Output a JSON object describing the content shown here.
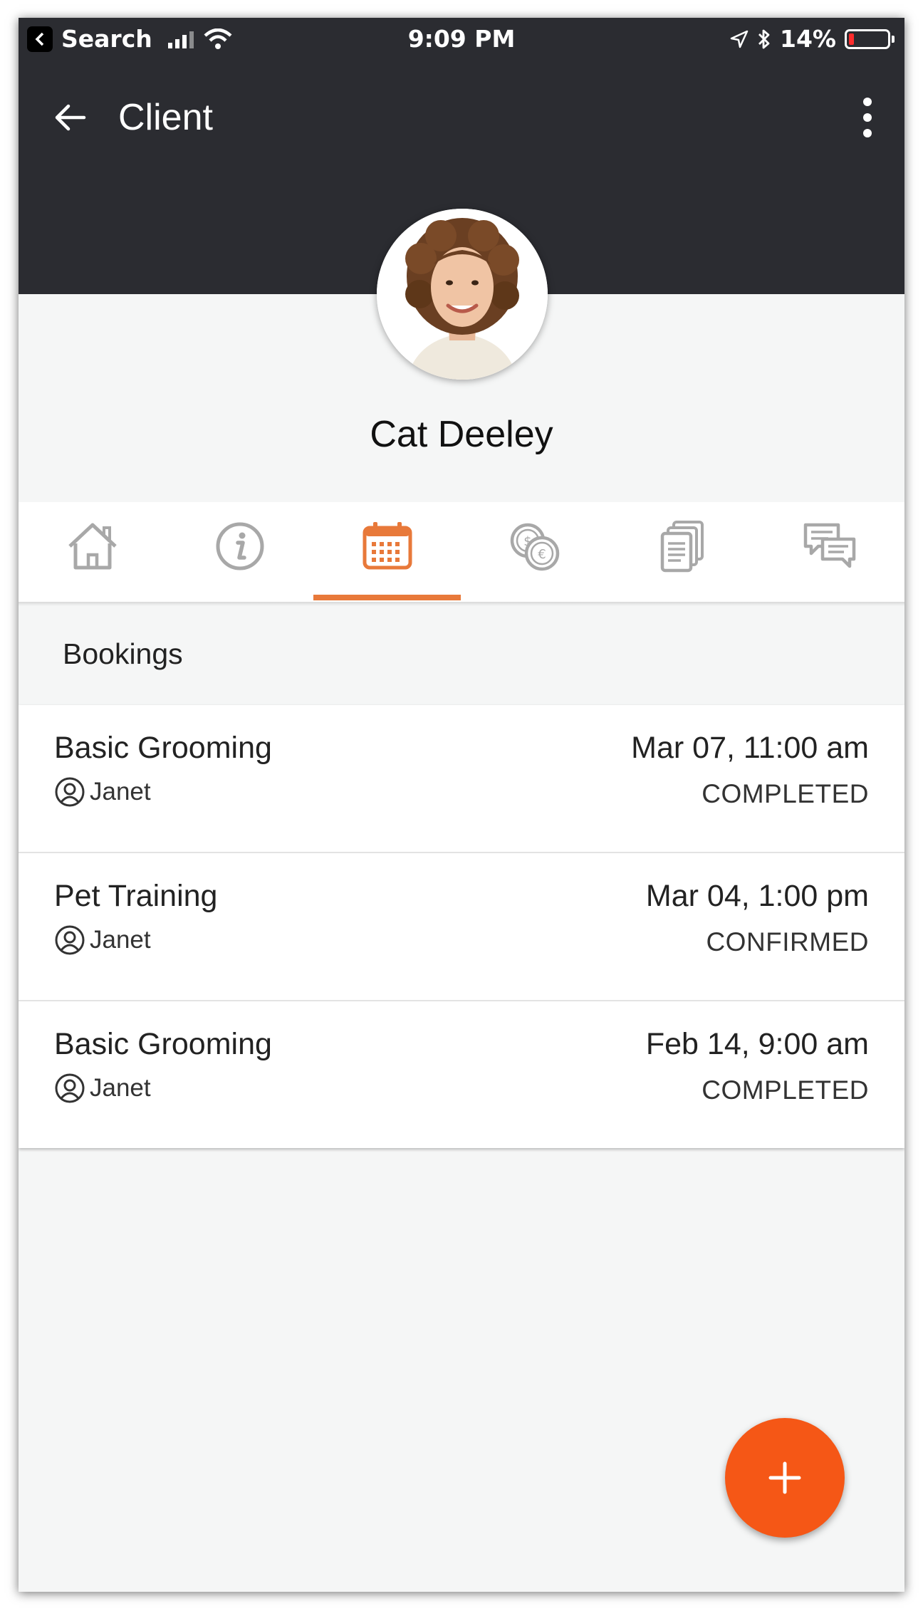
{
  "status_bar": {
    "carrier": "Search",
    "time": "9:09 PM",
    "battery": "14%",
    "battery_level": 0.14
  },
  "header": {
    "title": "Client"
  },
  "client": {
    "name": "Cat Deeley"
  },
  "tabs": [
    {
      "icon": "home-icon"
    },
    {
      "icon": "info-icon"
    },
    {
      "icon": "calendar-icon",
      "active": true
    },
    {
      "icon": "coins-icon"
    },
    {
      "icon": "documents-icon"
    },
    {
      "icon": "chat-icon"
    }
  ],
  "section_title": "Bookings",
  "bookings": [
    {
      "service": "Basic Grooming",
      "staff": "Janet",
      "date": "Mar 07, 11:00 am",
      "status": "COMPLETED"
    },
    {
      "service": "Pet Training",
      "staff": "Janet",
      "date": "Mar 04, 1:00 pm",
      "status": "CONFIRMED"
    },
    {
      "service": "Basic Grooming",
      "staff": "Janet",
      "date": "Feb 14, 9:00 am",
      "status": "COMPLETED"
    }
  ],
  "colors": {
    "accent": "#e8793a",
    "fab": "#f55716",
    "header": "#2b2c31",
    "tab_inactive": "#a8a8a8"
  }
}
